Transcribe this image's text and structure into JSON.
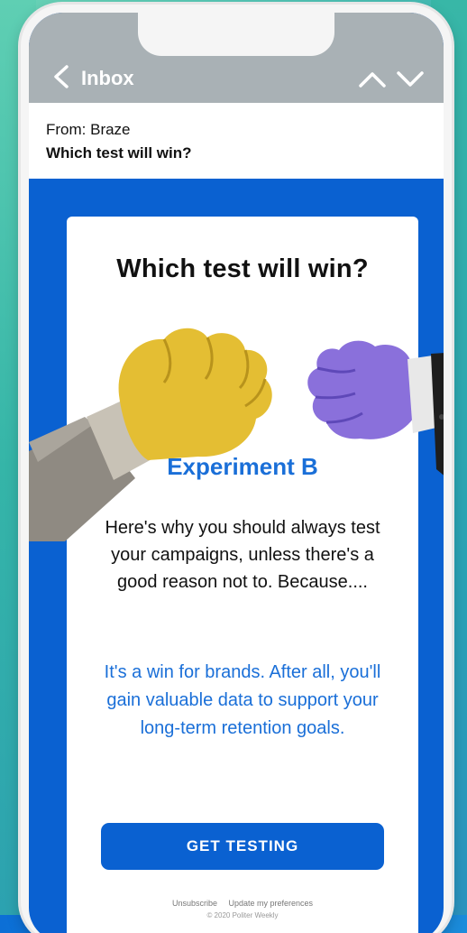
{
  "nav": {
    "back_label": "Inbox"
  },
  "email": {
    "from": "From: Braze",
    "subject": "Which test will win?"
  },
  "card": {
    "title": "Which test will win?",
    "experiment_label": "Experiment B",
    "body_text": "Here's why you should always test your campaigns, unless there's a good reason not to. Because....",
    "highlight_text": "It's a win for brands. After all, you'll gain valuable data to support your long-term retention goals.",
    "cta_label": "GET TESTING"
  },
  "footer": {
    "unsubscribe_label": "Unsubscribe",
    "preferences_label": "Update my preferences",
    "copyright": "© 2020 Politer Weekly"
  },
  "colors": {
    "brand_blue": "#0a61d1",
    "accent_blue": "#1a6fd8",
    "nav_gray": "#a9b1b5"
  },
  "icons": {
    "back": "chevron-left-icon",
    "up": "chevron-up-icon",
    "down": "chevron-down-icon"
  }
}
